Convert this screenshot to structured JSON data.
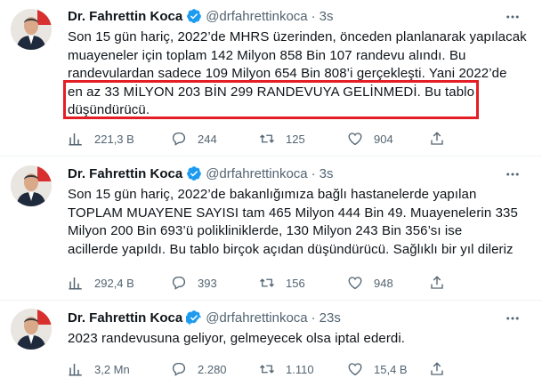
{
  "tweets": [
    {
      "author": {
        "name": "Dr. Fahrettin Koca",
        "handle": "@drfahrettinkoca",
        "verified": true
      },
      "dot": "·",
      "time": "3s",
      "lines": [
        "Son 15 gün hariç, 2022’de MHRS üzerinden, önceden planlanarak yapılacak",
        "muayeneler için toplam 142 Milyon 858 Bin 107 randevu alındı. Bu",
        "randevulardan sadece 109 Milyon 654 Bin 808’i gerçekleşti. Yani 2022’de",
        "en az 33 MİLYON 203 BİN 299 RANDEVUYA GELİNMEDİ. Bu tablo",
        "düşündürücü."
      ],
      "stats": {
        "views": "221,3 B",
        "replies": "244",
        "retweets": "125",
        "likes": "904"
      }
    },
    {
      "author": {
        "name": "Dr. Fahrettin Koca",
        "handle": "@drfahrettinkoca",
        "verified": true
      },
      "dot": "·",
      "time": "3s",
      "lines": [
        "Son 15 gün hariç, 2022’de bakanlığımıza bağlı hastanelerde yapılan",
        "TOPLAM MUAYENE SAYISI tam 465 Milyon 444 Bin 49. Muayenelerin 335",
        "Milyon 200 Bin 693’ü polikliniklerde, 130 Milyon 243 Bin 356’sı ise",
        "acillerde yapıldı. Bu tablo birçok açıdan düşündürücü. Sağlıklı bir yıl dileriz"
      ],
      "stats": {
        "views": "292,4 B",
        "replies": "393",
        "retweets": "156",
        "likes": "948"
      }
    },
    {
      "author": {
        "name": "Dr. Fahrettin Koca",
        "handle": "@drfahrettinkoca",
        "verified": true
      },
      "dot": "·",
      "time": "23s",
      "lines": [
        "2023 randevusuna geliyor, gelmeyecek olsa iptal ederdi."
      ],
      "stats": {
        "views": "3,2 Mn",
        "replies": "2.280",
        "retweets": "1.110",
        "likes": "15,4 B"
      }
    }
  ],
  "colors": {
    "accent": "#1d9bf0",
    "muted": "#536471",
    "highlight": "#e31e24"
  },
  "icons": [
    "views-icon",
    "reply-icon",
    "retweet-icon",
    "like-icon",
    "share-icon",
    "more-icon",
    "verified-badge-icon"
  ]
}
